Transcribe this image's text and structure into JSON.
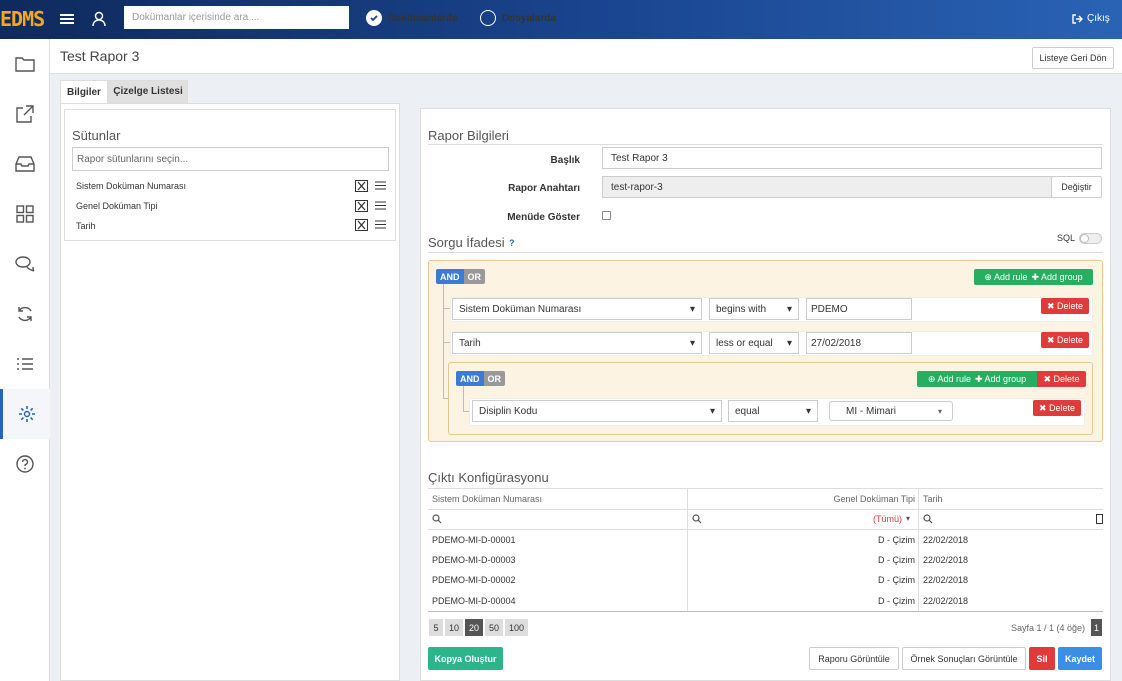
{
  "app": {
    "logo": "EDMS"
  },
  "topbar": {
    "search_placeholder": "Dokümanlar içerisinde ara ...",
    "radio_docs": "Dokümanlarda",
    "radio_files": "Dosyalarda",
    "logout": "Çıkış"
  },
  "page": {
    "title": "Test Rapor 3",
    "back_button": "Listeye Geri Dön"
  },
  "tabs": [
    {
      "label": "Bilgiler"
    },
    {
      "label": "Çizelge Listesi"
    }
  ],
  "columns": {
    "title": "Sütunlar",
    "placeholder": "Rapor sütunlarını seçin...",
    "items": [
      {
        "label": "Sistem Doküman Numarası"
      },
      {
        "label": "Genel Doküman Tipi"
      },
      {
        "label": "Tarih"
      }
    ]
  },
  "report": {
    "title": "Rapor Bilgileri",
    "baslik_label": "Başlık",
    "baslik_value": "Test Rapor 3",
    "key_label": "Rapor Anahtarı",
    "key_value": "test-rapor-3",
    "change_button": "Değiştir",
    "menu_label": "Menüde Göster"
  },
  "query": {
    "title": "Sorgu İfadesi",
    "help": "?",
    "sql_label": "SQL",
    "and": "AND",
    "or": "OR",
    "add_rule": "Add rule",
    "add_group": "Add group",
    "delete": "Delete",
    "rules": [
      {
        "field": "Sistem Doküman Numarası",
        "op": "begins with",
        "value": "PDEMO"
      },
      {
        "field": "Tarih",
        "op": "less or equal",
        "value": "27/02/2018"
      }
    ],
    "group_rule": {
      "field": "Disiplin Kodu",
      "op": "equal",
      "value": "MI - Mimari"
    }
  },
  "output": {
    "title": "Çıktı Konfigürasyonu",
    "headers": [
      "Sistem Doküman Numarası",
      "Genel Doküman Tipi",
      "Tarih"
    ],
    "filter_all": "(Tümü)",
    "rows": [
      [
        "PDEMO-MI-D-00001",
        "D - Çizim",
        "22/02/2018"
      ],
      [
        "PDEMO-MI-D-00003",
        "D - Çizim",
        "22/02/2018"
      ],
      [
        "PDEMO-MI-D-00002",
        "D - Çizim",
        "22/02/2018"
      ],
      [
        "PDEMO-MI-D-00004",
        "D - Çizim",
        "22/02/2018"
      ]
    ],
    "page_sizes": [
      "5",
      "10",
      "20",
      "50",
      "100"
    ],
    "page_info": "Sayfa 1 / 1 (4 öğe)",
    "current_page": "1"
  },
  "actions": {
    "copy": "Kopya Oluştur",
    "view_report": "Raporu Görüntüle",
    "view_samples": "Örnek Sonuçları Görüntüle",
    "delete": "Sil",
    "save": "Kaydet"
  },
  "colors": {
    "topbar": "#1a4590",
    "accent": "#2a63b5",
    "logo": "#f5a623",
    "green": "#27ae60",
    "red": "#e13a3a",
    "teal": "#2bb58a"
  }
}
